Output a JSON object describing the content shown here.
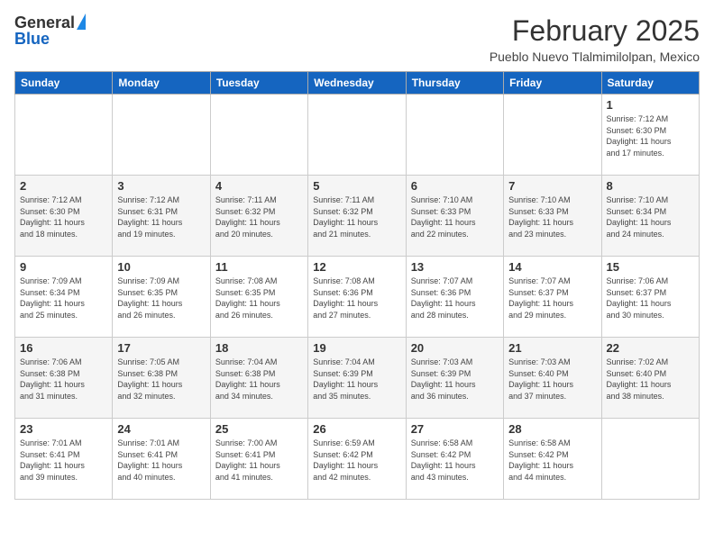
{
  "header": {
    "logo_general": "General",
    "logo_blue": "Blue",
    "month_title": "February 2025",
    "location": "Pueblo Nuevo Tlalmimilolpan, Mexico"
  },
  "days_of_week": [
    "Sunday",
    "Monday",
    "Tuesday",
    "Wednesday",
    "Thursday",
    "Friday",
    "Saturday"
  ],
  "weeks": [
    [
      {
        "day": "",
        "info": ""
      },
      {
        "day": "",
        "info": ""
      },
      {
        "day": "",
        "info": ""
      },
      {
        "day": "",
        "info": ""
      },
      {
        "day": "",
        "info": ""
      },
      {
        "day": "",
        "info": ""
      },
      {
        "day": "1",
        "info": "Sunrise: 7:12 AM\nSunset: 6:30 PM\nDaylight: 11 hours\nand 17 minutes."
      }
    ],
    [
      {
        "day": "2",
        "info": "Sunrise: 7:12 AM\nSunset: 6:30 PM\nDaylight: 11 hours\nand 18 minutes."
      },
      {
        "day": "3",
        "info": "Sunrise: 7:12 AM\nSunset: 6:31 PM\nDaylight: 11 hours\nand 19 minutes."
      },
      {
        "day": "4",
        "info": "Sunrise: 7:11 AM\nSunset: 6:32 PM\nDaylight: 11 hours\nand 20 minutes."
      },
      {
        "day": "5",
        "info": "Sunrise: 7:11 AM\nSunset: 6:32 PM\nDaylight: 11 hours\nand 21 minutes."
      },
      {
        "day": "6",
        "info": "Sunrise: 7:10 AM\nSunset: 6:33 PM\nDaylight: 11 hours\nand 22 minutes."
      },
      {
        "day": "7",
        "info": "Sunrise: 7:10 AM\nSunset: 6:33 PM\nDaylight: 11 hours\nand 23 minutes."
      },
      {
        "day": "8",
        "info": "Sunrise: 7:10 AM\nSunset: 6:34 PM\nDaylight: 11 hours\nand 24 minutes."
      }
    ],
    [
      {
        "day": "9",
        "info": "Sunrise: 7:09 AM\nSunset: 6:34 PM\nDaylight: 11 hours\nand 25 minutes."
      },
      {
        "day": "10",
        "info": "Sunrise: 7:09 AM\nSunset: 6:35 PM\nDaylight: 11 hours\nand 26 minutes."
      },
      {
        "day": "11",
        "info": "Sunrise: 7:08 AM\nSunset: 6:35 PM\nDaylight: 11 hours\nand 26 minutes."
      },
      {
        "day": "12",
        "info": "Sunrise: 7:08 AM\nSunset: 6:36 PM\nDaylight: 11 hours\nand 27 minutes."
      },
      {
        "day": "13",
        "info": "Sunrise: 7:07 AM\nSunset: 6:36 PM\nDaylight: 11 hours\nand 28 minutes."
      },
      {
        "day": "14",
        "info": "Sunrise: 7:07 AM\nSunset: 6:37 PM\nDaylight: 11 hours\nand 29 minutes."
      },
      {
        "day": "15",
        "info": "Sunrise: 7:06 AM\nSunset: 6:37 PM\nDaylight: 11 hours\nand 30 minutes."
      }
    ],
    [
      {
        "day": "16",
        "info": "Sunrise: 7:06 AM\nSunset: 6:38 PM\nDaylight: 11 hours\nand 31 minutes."
      },
      {
        "day": "17",
        "info": "Sunrise: 7:05 AM\nSunset: 6:38 PM\nDaylight: 11 hours\nand 32 minutes."
      },
      {
        "day": "18",
        "info": "Sunrise: 7:04 AM\nSunset: 6:38 PM\nDaylight: 11 hours\nand 34 minutes."
      },
      {
        "day": "19",
        "info": "Sunrise: 7:04 AM\nSunset: 6:39 PM\nDaylight: 11 hours\nand 35 minutes."
      },
      {
        "day": "20",
        "info": "Sunrise: 7:03 AM\nSunset: 6:39 PM\nDaylight: 11 hours\nand 36 minutes."
      },
      {
        "day": "21",
        "info": "Sunrise: 7:03 AM\nSunset: 6:40 PM\nDaylight: 11 hours\nand 37 minutes."
      },
      {
        "day": "22",
        "info": "Sunrise: 7:02 AM\nSunset: 6:40 PM\nDaylight: 11 hours\nand 38 minutes."
      }
    ],
    [
      {
        "day": "23",
        "info": "Sunrise: 7:01 AM\nSunset: 6:41 PM\nDaylight: 11 hours\nand 39 minutes."
      },
      {
        "day": "24",
        "info": "Sunrise: 7:01 AM\nSunset: 6:41 PM\nDaylight: 11 hours\nand 40 minutes."
      },
      {
        "day": "25",
        "info": "Sunrise: 7:00 AM\nSunset: 6:41 PM\nDaylight: 11 hours\nand 41 minutes."
      },
      {
        "day": "26",
        "info": "Sunrise: 6:59 AM\nSunset: 6:42 PM\nDaylight: 11 hours\nand 42 minutes."
      },
      {
        "day": "27",
        "info": "Sunrise: 6:58 AM\nSunset: 6:42 PM\nDaylight: 11 hours\nand 43 minutes."
      },
      {
        "day": "28",
        "info": "Sunrise: 6:58 AM\nSunset: 6:42 PM\nDaylight: 11 hours\nand 44 minutes."
      },
      {
        "day": "",
        "info": ""
      }
    ]
  ]
}
